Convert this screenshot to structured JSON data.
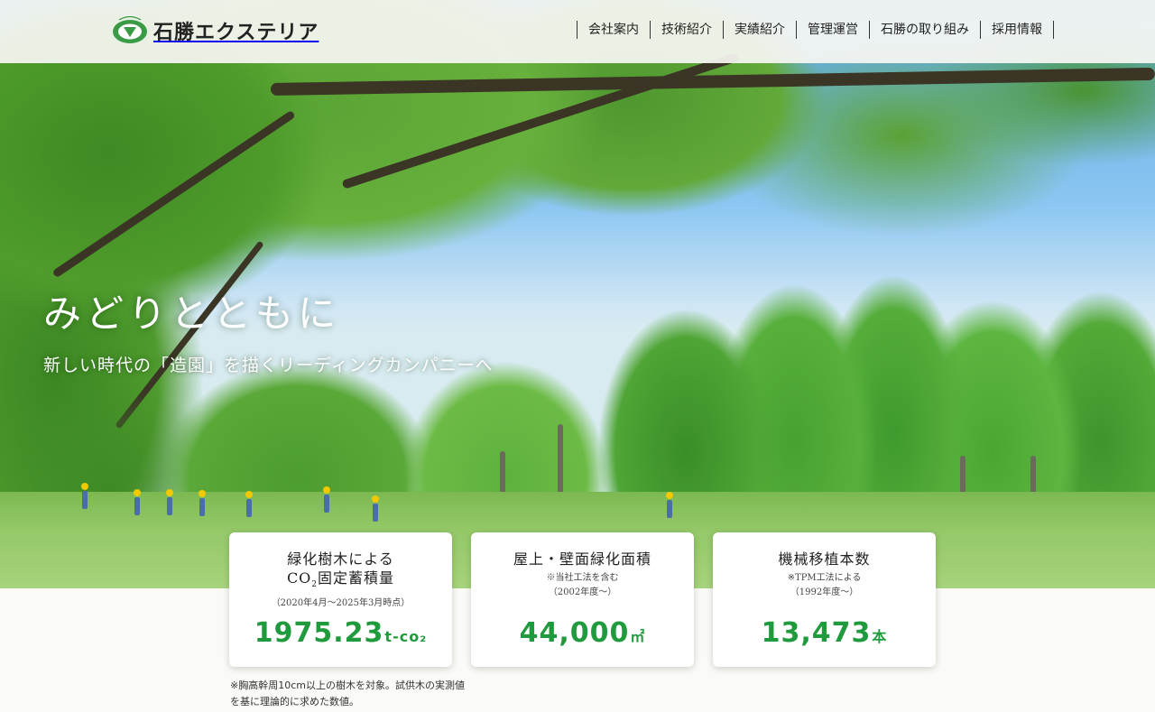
{
  "brand": {
    "name": "石勝エクステリア",
    "logo_icon": "ishikatsu-logo-icon",
    "accent_color": "#1f9a3c"
  },
  "nav": {
    "items": [
      {
        "label": "会社案内"
      },
      {
        "label": "技術紹介"
      },
      {
        "label": "実績紹介"
      },
      {
        "label": "管理運営"
      },
      {
        "label": "石勝の取り組み"
      },
      {
        "label": "採用情報"
      }
    ]
  },
  "hero": {
    "title": "みどりとともに",
    "subtitle": "新しい時代の「造園」を描くリーディングカンパニーへ"
  },
  "stats": [
    {
      "title_line1": "緑化樹木による",
      "title_line2_pre": "CO",
      "title_line2_sub": "2",
      "title_line2_post": "固定蓄積量",
      "note1": "（2020年4月～2025年3月時点）",
      "value": "1975.23",
      "unit": "t-co₂"
    },
    {
      "title_line1": "屋上・壁面緑化面積",
      "note1": "※当社工法を含む",
      "note2": "（2002年度～）",
      "value": "44,000",
      "unit": "㎡"
    },
    {
      "title_line1": "機械移植本数",
      "note1": "※TPM工法による",
      "note2": "（1992年度～）",
      "value": "13,473",
      "unit": "本"
    }
  ],
  "footnote": "※胸高幹周10cm以上の樹木を対象。試供木の実測値を基に理論的に求めた数値。"
}
